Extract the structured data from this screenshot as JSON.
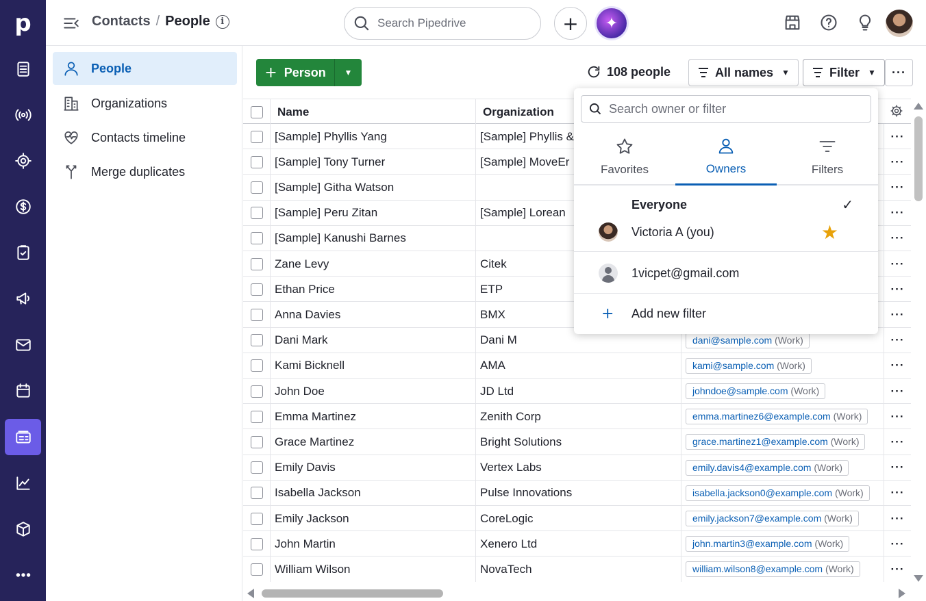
{
  "app": {
    "logo": "p"
  },
  "rail": {
    "items": [
      {
        "icon": "leads-inbox-icon",
        "active": false
      },
      {
        "icon": "broadcast-icon",
        "active": false
      },
      {
        "icon": "target-icon",
        "active": false
      },
      {
        "icon": "dollar-icon",
        "active": false
      },
      {
        "icon": "clipboard-check-icon",
        "active": false
      },
      {
        "icon": "megaphone-icon",
        "active": false
      },
      {
        "icon": "mail-icon",
        "active": false
      },
      {
        "icon": "calendar-icon",
        "active": false
      },
      {
        "icon": "contacts-card-icon",
        "active": true
      },
      {
        "icon": "chart-icon",
        "active": false
      },
      {
        "icon": "box-icon",
        "active": false
      },
      {
        "icon": "more-horizontal-icon",
        "active": false
      }
    ]
  },
  "header": {
    "breadcrumb_parent": "Contacts",
    "breadcrumb_sep": "/",
    "breadcrumb_current": "People",
    "info_glyph": "i",
    "search_placeholder": "Search Pipedrive",
    "plus_glyph": "+",
    "ai_glyph": "✦"
  },
  "sidebar": {
    "items": [
      {
        "label": "People",
        "icon": "person-icon",
        "active": true
      },
      {
        "label": "Organizations",
        "icon": "building-icon",
        "active": false
      },
      {
        "label": "Contacts timeline",
        "icon": "heartbeat-icon",
        "active": false
      },
      {
        "label": "Merge duplicates",
        "icon": "merge-icon",
        "active": false
      }
    ]
  },
  "toolbar": {
    "add_plus": "+",
    "add_label": "Person",
    "count_label": "108 people",
    "names_filter_label": "All names",
    "filter_label": "Filter",
    "more_label": "···"
  },
  "table": {
    "columns": {
      "name": "Name",
      "organization": "Organization"
    },
    "more_glyph": "···",
    "work_label": "(Work)",
    "rows": [
      {
        "name": "[Sample] Phyllis Yang",
        "org": "[Sample] Phyllis & Sons",
        "email": ""
      },
      {
        "name": "[Sample] Tony Turner",
        "org": "[Sample] MoveEr",
        "email": ""
      },
      {
        "name": "[Sample] Githa Watson",
        "org": "",
        "email": ""
      },
      {
        "name": "[Sample] Peru Zitan",
        "org": "[Sample] Lorean",
        "email": ""
      },
      {
        "name": "[Sample] Kanushi Barnes",
        "org": "",
        "email": ""
      },
      {
        "name": "Zane Levy",
        "org": "Citek",
        "email": ""
      },
      {
        "name": "Ethan Price",
        "org": "ETP",
        "email": ""
      },
      {
        "name": "Anna Davies",
        "org": "BMX",
        "email": ""
      },
      {
        "name": "Dani Mark",
        "org": "Dani M",
        "email": "dani@sample.com"
      },
      {
        "name": "Kami Bicknell",
        "org": "AMA",
        "email": "kami@sample.com"
      },
      {
        "name": "John Doe",
        "org": "JD Ltd",
        "email": "johndoe@sample.com"
      },
      {
        "name": "Emma Martinez",
        "org": "Zenith Corp",
        "email": "emma.martinez6@example.com"
      },
      {
        "name": "Grace Martinez",
        "org": "Bright Solutions",
        "email": "grace.martinez1@example.com"
      },
      {
        "name": "Emily Davis",
        "org": "Vertex Labs",
        "email": "emily.davis4@example.com"
      },
      {
        "name": "Isabella Jackson",
        "org": "Pulse Innovations",
        "email": "isabella.jackson0@example.com"
      },
      {
        "name": "Emily Jackson",
        "org": "CoreLogic",
        "email": "emily.jackson7@example.com"
      },
      {
        "name": "John Martin",
        "org": "Xenero Ltd",
        "email": "john.martin3@example.com"
      },
      {
        "name": "William Wilson",
        "org": "NovaTech",
        "email": "william.wilson8@example.com"
      }
    ]
  },
  "dropdown": {
    "search_placeholder": "Search owner or filter",
    "tabs": [
      {
        "label": "Favorites",
        "icon": "star-outline-icon",
        "active": false
      },
      {
        "label": "Owners",
        "icon": "person-icon",
        "active": true
      },
      {
        "label": "Filters",
        "icon": "filter-lines-icon",
        "active": false
      }
    ],
    "everyone_label": "Everyone",
    "check_glyph": "✓",
    "owner_label": "Victoria A (you)",
    "star_glyph": "★",
    "user_email": "1vicpet@gmail.com",
    "add_plus": "+",
    "add_filter_label": "Add new filter"
  },
  "colors": {
    "rail_bg": "#26235a",
    "rail_active": "#6b5ce7",
    "primary_green": "#23863b",
    "link_blue": "#0a5fb4",
    "star": "#e8a20a"
  }
}
